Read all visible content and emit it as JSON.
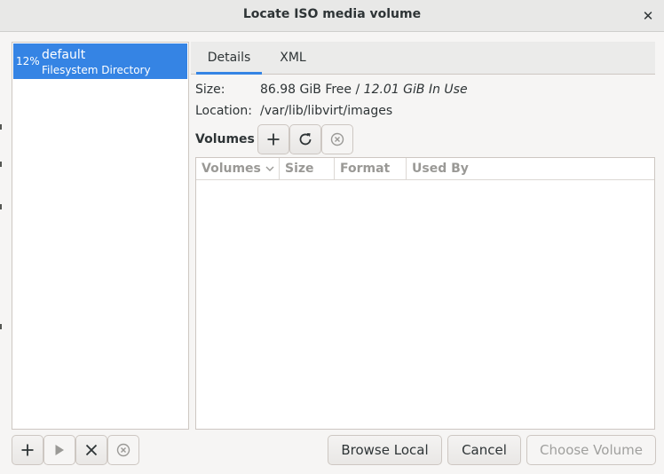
{
  "window": {
    "title": "Locate ISO media volume",
    "close_glyph": "✕"
  },
  "pools": [
    {
      "usage": "12%",
      "name": "default",
      "type": "Filesystem Directory",
      "selected": true
    }
  ],
  "pool_toolbar": {
    "icons": [
      "add-icon",
      "play-icon",
      "stop-icon",
      "delete-icon"
    ]
  },
  "tabs": [
    {
      "label": "Details",
      "active": true
    },
    {
      "label": "XML",
      "active": false
    }
  ],
  "details": {
    "size_label": "Size:",
    "size_free": "86.98 GiB Free",
    "size_sep": " / ",
    "size_in_use": "12.01 GiB In Use",
    "location_label": "Location:",
    "location_value": "/var/lib/libvirt/images",
    "volumes_heading": "Volumes"
  },
  "volume_toolbar": {
    "icons": [
      "add-icon",
      "refresh-icon",
      "delete-icon"
    ]
  },
  "volume_table": {
    "columns": [
      "Volumes",
      "Size",
      "Format",
      "Used By"
    ],
    "rows": []
  },
  "buttons": {
    "browse_local": "Browse Local",
    "cancel": "Cancel",
    "choose_volume": "Choose Volume"
  },
  "colors": {
    "accent": "#3584e4",
    "disabled_text": "#a0a09e"
  }
}
